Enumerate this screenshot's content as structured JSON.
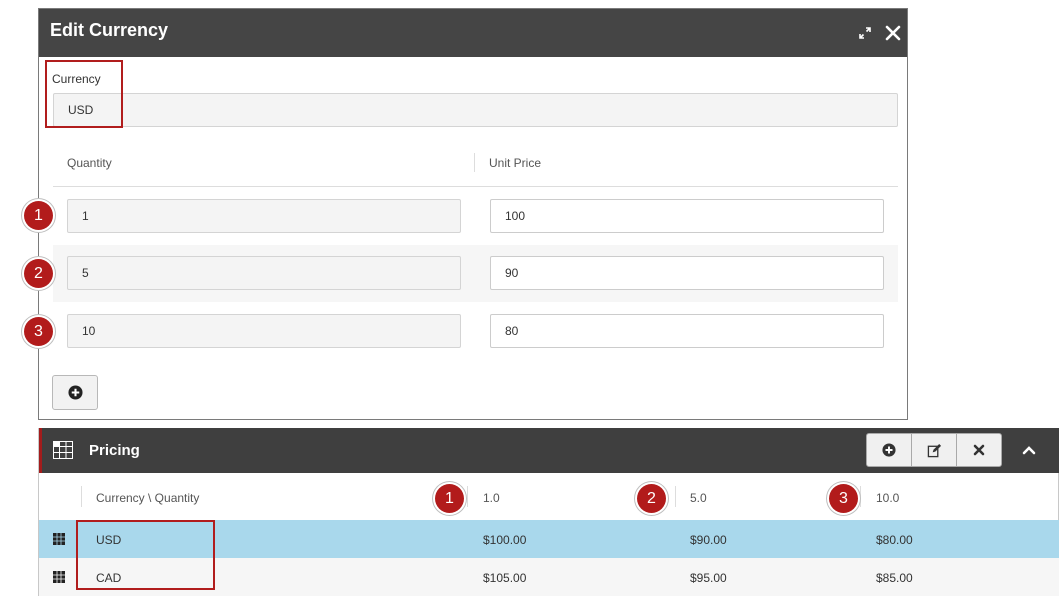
{
  "dialog": {
    "title": "Edit Currency",
    "currency_label": "Currency",
    "currency_value": "USD",
    "col_quantity": "Quantity",
    "col_unit_price": "Unit Price",
    "rows": [
      {
        "badge": "1",
        "quantity": "1",
        "unit_price": "100"
      },
      {
        "badge": "2",
        "quantity": "5",
        "unit_price": "90"
      },
      {
        "badge": "3",
        "quantity": "10",
        "unit_price": "80"
      }
    ]
  },
  "pricing": {
    "title": "Pricing",
    "header_first": "Currency \\ Quantity",
    "columns": [
      {
        "badge": "1",
        "label": "1.0"
      },
      {
        "badge": "2",
        "label": "5.0"
      },
      {
        "badge": "3",
        "label": "10.0"
      }
    ],
    "rows": [
      {
        "currency": "USD",
        "values": [
          "$100.00",
          "$90.00",
          "$80.00"
        ]
      },
      {
        "currency": "CAD",
        "values": [
          "$105.00",
          "$95.00",
          "$85.00"
        ]
      }
    ]
  },
  "colors": {
    "header_dark": "#454545",
    "badge_red": "#b21b1b",
    "selected_row": "#a9d8ec"
  },
  "icons": {
    "expand": "expand-icon",
    "close": "close-icon",
    "add": "plus-circle-icon",
    "edit": "edit-icon",
    "delete": "x-icon",
    "collapse": "chevron-up-icon",
    "grid": "grid-icon"
  }
}
